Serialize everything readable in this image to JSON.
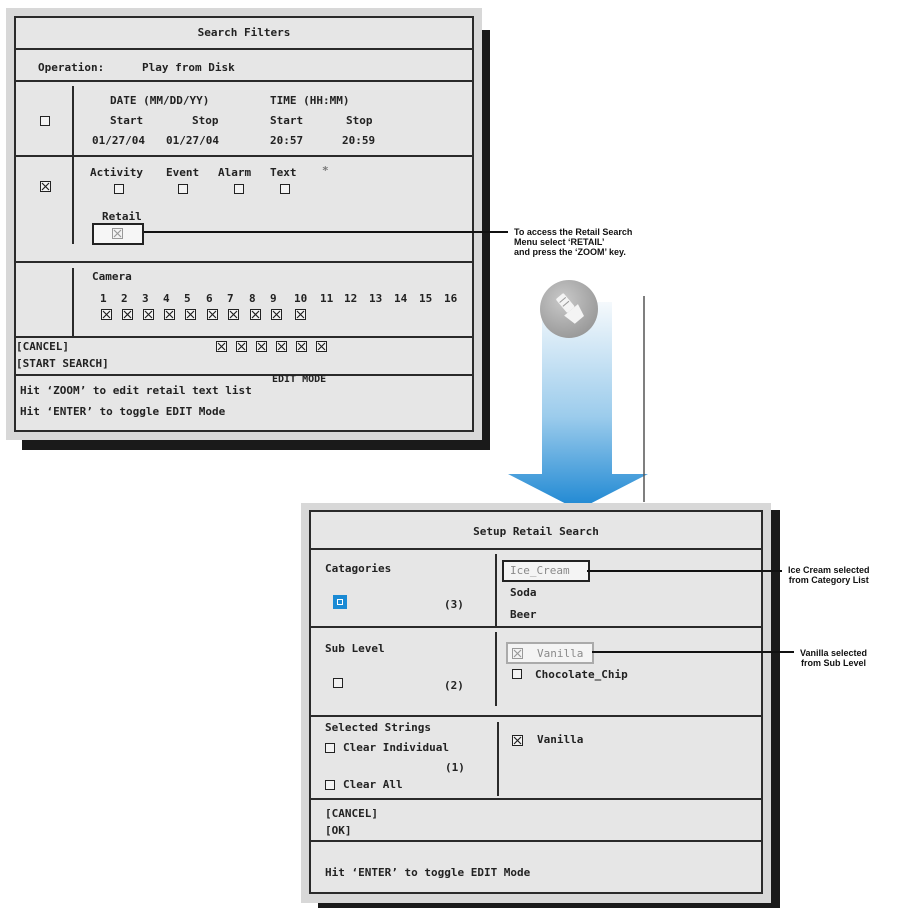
{
  "search_filters": {
    "title": "Search Filters",
    "operation_label": "Operation:",
    "operation_value": "Play from Disk",
    "date_header": "DATE (MM/DD/YY)",
    "time_header": "TIME (HH:MM)",
    "col_start": "Start",
    "col_stop": "Stop",
    "date_start": "01/27/04",
    "date_stop": "01/27/04",
    "time_start": "20:57",
    "time_stop": "20:59",
    "activity": "Activity",
    "event": "Event",
    "alarm": "Alarm",
    "text": "Text",
    "asterisk": "*",
    "retail": "Retail",
    "camera": "Camera",
    "camera_numbers": [
      "1",
      "2",
      "3",
      "4",
      "5",
      "6",
      "7",
      "8",
      "9",
      "10",
      "11",
      "12",
      "13",
      "14",
      "15",
      "16"
    ],
    "camera_checked": 10,
    "extra_checked": 6,
    "cancel": "[CANCEL]",
    "start_search": "[START SEARCH]",
    "edit_mode": "EDIT MODE",
    "hint_zoom": "Hit ‘ZOOM’ to edit retail text list",
    "hint_enter": "Hit ‘ENTER’ to toggle EDIT Mode"
  },
  "callout_retail": {
    "line1": "To access the Retail Search",
    "line2": "Menu select ‘RETAIL’",
    "line3": "and press the ‘ZOOM’ key."
  },
  "setup_retail": {
    "title": "Setup Retail Search",
    "categories_label": "Catagories",
    "categories_count": "(3)",
    "categories": [
      "Ice_Cream",
      "Soda",
      "Beer"
    ],
    "sublevel_label": "Sub Level",
    "sublevel_count": "(2)",
    "sublevels": [
      "Vanilla",
      "Chocolate_Chip"
    ],
    "selected_strings_label": "Selected Strings",
    "clear_individual": "Clear Individual",
    "clear_all": "Clear All",
    "selected_count": "(1)",
    "selected_items": [
      "Vanilla"
    ],
    "cancel": "[CANCEL]",
    "ok": "[OK]",
    "hint_enter": "Hit ‘ENTER’ to toggle EDIT Mode"
  },
  "callout_icecream": {
    "line1": "Ice Cream selected",
    "line2": "from Category List"
  },
  "callout_vanilla": {
    "line1": "Vanilla selected",
    "line2": "from Sub Level"
  },
  "colors": {
    "panel_bg": "#e6e6e6",
    "arrow_top": "#f2f8fc",
    "arrow_bottom": "#1b86d2",
    "accent_blue": "#1a8ad4"
  },
  "icons": {
    "zoom_button": "flashlight-icon"
  }
}
